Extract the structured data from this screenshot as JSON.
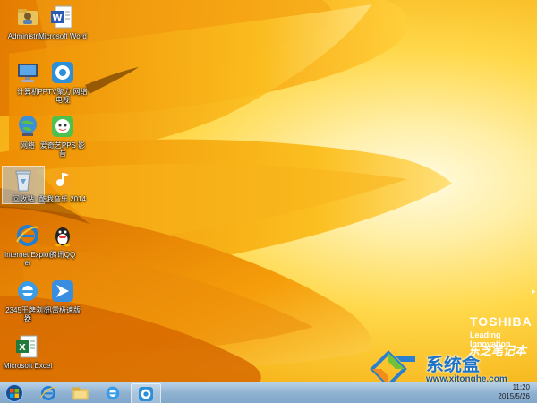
{
  "desktop_icons": [
    {
      "name": "administrator-folder",
      "label": "Administra...",
      "icon": "folder-icon",
      "selected": false
    },
    {
      "name": "microsoft-word",
      "label": "Microsoft Word",
      "icon": "word-icon",
      "selected": false
    },
    {
      "name": "computer",
      "label": "计算机",
      "icon": "computer-icon",
      "selected": false
    },
    {
      "name": "pptv",
      "label": "PPTV聚力 网络电视",
      "icon": "pptv-icon",
      "selected": false
    },
    {
      "name": "network",
      "label": "网络",
      "icon": "network-icon",
      "selected": false
    },
    {
      "name": "iqiyi-pps",
      "label": "爱奇艺PPS 影音",
      "icon": "iqiyi-icon",
      "selected": false
    },
    {
      "name": "recycle-bin",
      "label": "回收站",
      "icon": "recycle-bin-icon",
      "selected": true
    },
    {
      "name": "kuwo-music",
      "label": "酷我音乐 2014",
      "icon": "kuwo-icon",
      "selected": false
    },
    {
      "name": "internet-explorer",
      "label": "Internet Explorer",
      "icon": "ie-icon",
      "selected": false
    },
    {
      "name": "tencent-qq",
      "label": "腾讯QQ",
      "icon": "qq-icon",
      "selected": false
    },
    {
      "name": "2345-browser",
      "label": "2345王牌浏览器",
      "icon": "browser-2345-icon",
      "selected": false
    },
    {
      "name": "xunlei",
      "label": "迅雷极速版",
      "icon": "xunlei-icon",
      "selected": false
    },
    {
      "name": "microsoft-excel",
      "label": "Microsoft Excel",
      "icon": "excel-icon",
      "selected": false
    }
  ],
  "branding": {
    "main": "TOSHIBA",
    "tagline": "Leading Innovation",
    "chinese": "东芝笔记本"
  },
  "watermark": {
    "title": "系统盒",
    "url": "www.xitonghe.com"
  },
  "taskbar": {
    "items": [
      {
        "name": "start-button",
        "icon": "windows-start-icon"
      },
      {
        "name": "taskbar-ie",
        "icon": "ie-icon"
      },
      {
        "name": "taskbar-explorer",
        "icon": "folder-icon"
      },
      {
        "name": "taskbar-browser",
        "icon": "browser-icon"
      },
      {
        "name": "taskbar-pptv",
        "icon": "pptv-icon"
      }
    ],
    "clock": {
      "time": "11:20",
      "date": "2015/5/26"
    }
  },
  "colors": {
    "wallpaper_light": "#fff6c8",
    "wallpaper_mid": "#fbc31c",
    "wallpaper_dark": "#e98b05",
    "taskbar": "#9fbedc",
    "watermark_blue": "#1e74c8"
  }
}
